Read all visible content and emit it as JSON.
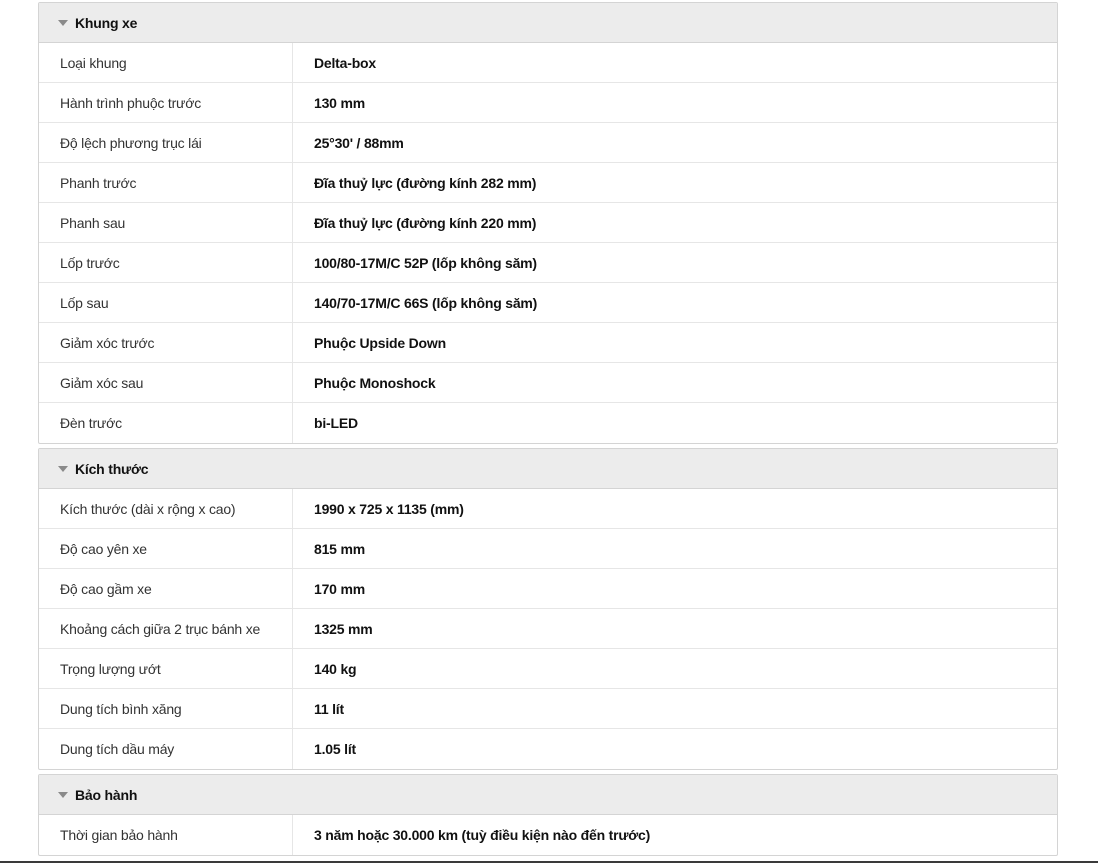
{
  "sections": [
    {
      "title": "Khung xe",
      "rows": [
        {
          "label": "Loại khung",
          "value": "Delta-box"
        },
        {
          "label": "Hành trình phuộc trước",
          "value": "130 mm"
        },
        {
          "label": "Độ lệch phương trục lái",
          "value": "25°30' / 88mm"
        },
        {
          "label": "Phanh trước",
          "value": "Đĩa thuỷ lực (đường kính 282 mm)"
        },
        {
          "label": "Phanh sau",
          "value": "Đĩa thuỷ lực (đường kính 220 mm)"
        },
        {
          "label": "Lốp trước",
          "value": "100/80-17M/C 52P (lốp không săm)"
        },
        {
          "label": "Lốp sau",
          "value": "140/70-17M/C 66S (lốp không săm)"
        },
        {
          "label": "Giảm xóc trước",
          "value": "Phuộc Upside Down"
        },
        {
          "label": "Giảm xóc sau",
          "value": "Phuộc Monoshock"
        },
        {
          "label": "Đèn trước",
          "value": "bi-LED"
        }
      ]
    },
    {
      "title": "Kích thước",
      "rows": [
        {
          "label": "Kích thước (dài x rộng x cao)",
          "value": "1990 x 725 x 1135 (mm)"
        },
        {
          "label": "Độ cao yên xe",
          "value": "815 mm"
        },
        {
          "label": "Độ cao gầm xe",
          "value": "170 mm"
        },
        {
          "label": "Khoảng cách giữa 2 trục bánh xe",
          "value": "1325 mm"
        },
        {
          "label": "Trọng lượng ướt",
          "value": "140 kg"
        },
        {
          "label": "Dung tích bình xăng",
          "value": "11 lít"
        },
        {
          "label": "Dung tích dầu máy",
          "value": "1.05 lít"
        }
      ]
    },
    {
      "title": "Bảo hành",
      "rows": [
        {
          "label": "Thời gian bảo hành",
          "value": "3 năm hoặc 30.000 km (tuỳ điều kiện nào đến trước)"
        }
      ]
    }
  ]
}
